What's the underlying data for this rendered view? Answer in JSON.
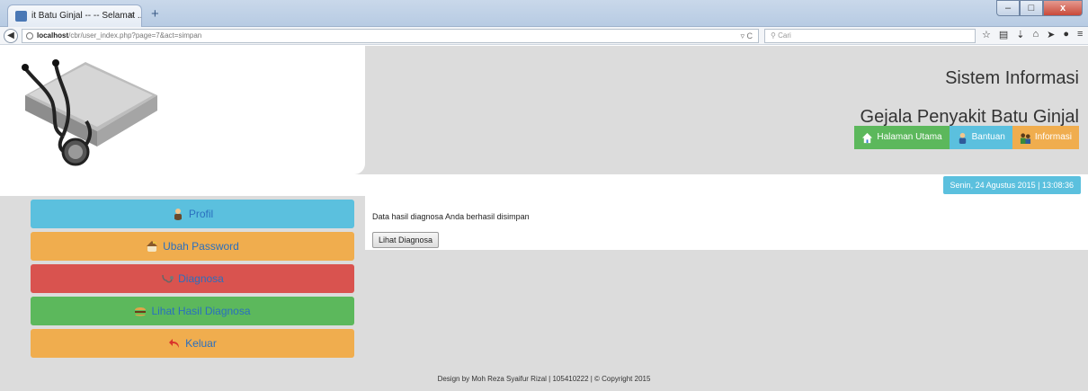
{
  "browser": {
    "tab_title": "it Batu Ginjal -- -- Selamat ...",
    "tab_close": "×",
    "new_tab": "+",
    "url_host": "localhost",
    "url_path": "/cbr/user_index.php?page=7&act=simpan",
    "search_placeholder": "Cari",
    "window_controls": {
      "minimize": "–",
      "maximize": "□",
      "close": "x"
    }
  },
  "header": {
    "title_line1": "Sistem Informasi",
    "title_line2": "Gejala Penyakit Batu Ginjal",
    "nav": [
      {
        "label": "Halaman Utama",
        "icon": "home-icon",
        "color": "#5cb85c"
      },
      {
        "label": "Bantuan",
        "icon": "user-help-icon",
        "color": "#5bc0de"
      },
      {
        "label": "Informasi",
        "icon": "info-people-icon",
        "color": "#f0ad4e"
      }
    ]
  },
  "datetime": "Senin, 24 Agustus 2015   |   13:08:36",
  "sidebar": {
    "items": [
      {
        "label": "Profil",
        "icon": "user-icon",
        "bg": "#5bc0de",
        "fg": "#2a6fbf"
      },
      {
        "label": "Ubah Password",
        "icon": "key-house-icon",
        "bg": "#f0ad4e",
        "fg": "#2a6fbf"
      },
      {
        "label": "Diagnosa",
        "icon": "stethoscope-icon",
        "bg": "#d9534f",
        "fg": "#2a6fbf"
      },
      {
        "label": "Lihat Hasil Diagnosa",
        "icon": "burger-icon",
        "bg": "#5cb85c",
        "fg": "#2a6fbf"
      },
      {
        "label": "Keluar",
        "icon": "exit-arrow-icon",
        "bg": "#f0ad4e",
        "fg": "#2a6fbf"
      }
    ]
  },
  "main": {
    "message": "Data hasil diagnosa Anda berhasil disimpan",
    "button_label": "Lihat Diagnosa"
  },
  "footer": "Design by Moh Reza Syaifur Rizal | 105410222 | © Copyright 2015"
}
